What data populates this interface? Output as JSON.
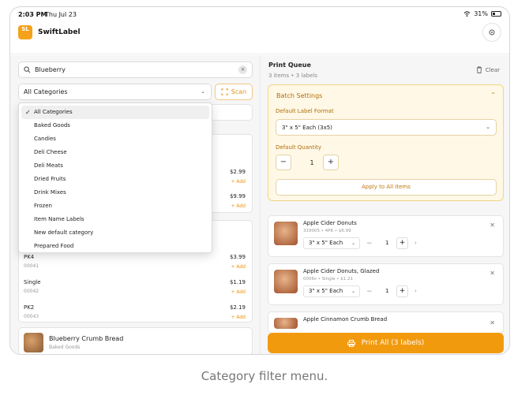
{
  "status": {
    "time": "2:03 PM",
    "date": "Thu Jul 23",
    "battery": "31%"
  },
  "app": {
    "logo_text": "SL",
    "title": "SwiftLabel",
    "settings_icon": "gear-icon"
  },
  "search": {
    "value": "Blueberry",
    "clear_symbol": "×"
  },
  "filter": {
    "selected": "All Categories",
    "scan_label": "Scan"
  },
  "dropdown": {
    "items": [
      "All Categories",
      "Baked Goods",
      "Candies",
      "Deli Cheese",
      "Deli Meats",
      "Dried Fruits",
      "Drink Mixes",
      "Frozen",
      "Item Name Labels",
      "New default category",
      "Prepared Food"
    ],
    "selected_index": 0
  },
  "results": {
    "upper_rows": [
      {
        "price": "$2.99",
        "add": "+ Add"
      },
      {
        "price": "$9.99",
        "add": "+ Add"
      }
    ],
    "variant_rows": [
      {
        "name": "PK4",
        "sku": "00041",
        "price": "$3.99",
        "add": "+ Add"
      },
      {
        "name": "Single",
        "sku": "00042",
        "price": "$1.19",
        "add": "+ Add"
      },
      {
        "name": "PK2",
        "sku": "00043",
        "price": "$2.19",
        "add": "+ Add"
      }
    ],
    "product": {
      "name": "Blueberry Crumb Bread",
      "category": "Baked Goods"
    }
  },
  "queue": {
    "title": "Print Queue",
    "subtitle": "3 items • 3 labels",
    "clear_label": "Clear",
    "batch": {
      "title": "Batch Settings",
      "format_label": "Default Label Format",
      "format_value": "3\" x 5\" Each (3x5)",
      "quantity_label": "Default Quantity",
      "quantity": "1",
      "apply_label": "Apply to All Items"
    },
    "items": [
      {
        "name": "Apple Cider Donuts",
        "meta": "319005 • 4PK • $6.99",
        "size": "3\" x 5\" Each",
        "qty": "1"
      },
      {
        "name": "Apple Cider Donuts, Glazed",
        "meta": "0006s • Single • $1.21",
        "size": "3\" x 5\" Each",
        "qty": "1"
      },
      {
        "name": "Apple Cinnamon Crumb Bread"
      }
    ],
    "print_label": "Print All (3 labels)"
  },
  "caption": "Category filter menu.",
  "colors": {
    "accent": "#f29a0e",
    "batch_bg": "#fff8e6"
  }
}
